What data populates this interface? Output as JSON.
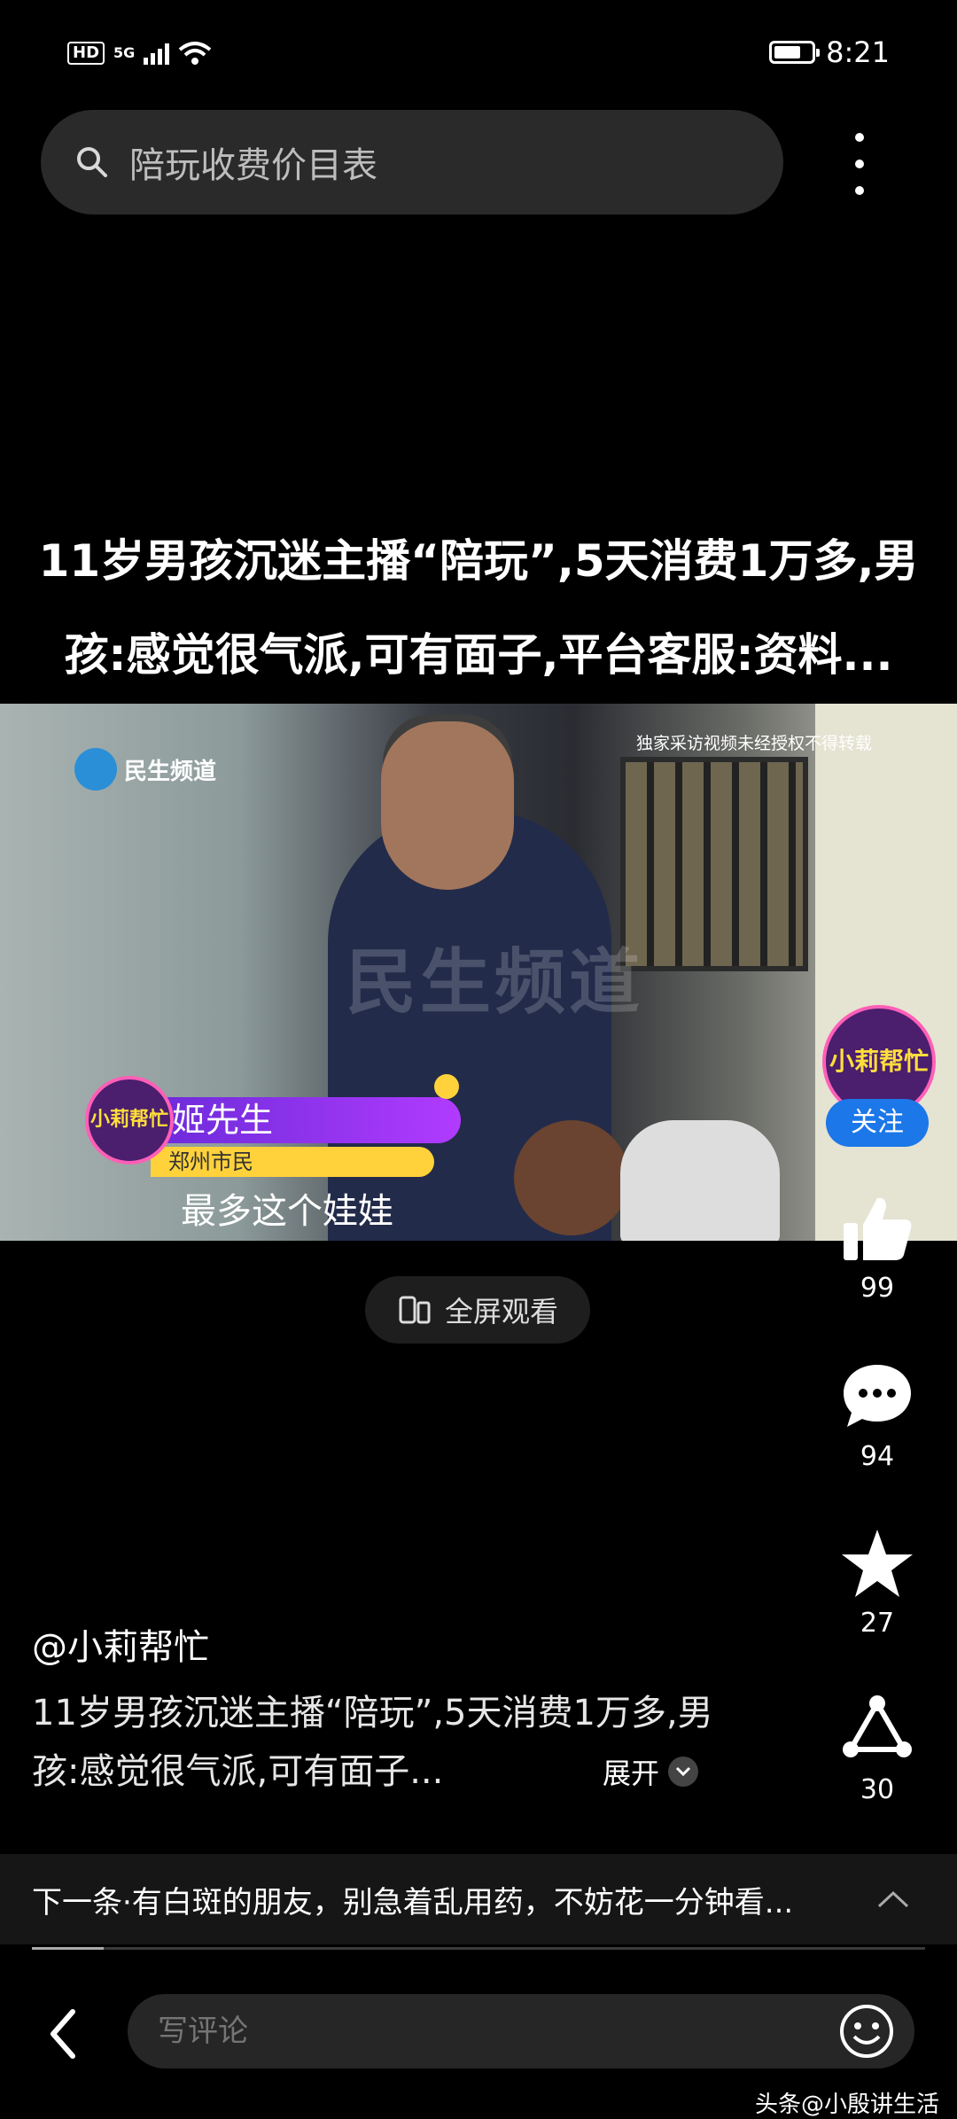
{
  "status_bar": {
    "hd": "HD",
    "network": "5G",
    "time": "8:21",
    "battery_level": 0.75
  },
  "search": {
    "placeholder": "陪玩收费价目表"
  },
  "video_title": "11岁男孩沉迷主播“陪玩”,5天消费1万多,男孩:感觉很气派,可有面子,平台客服:资料...",
  "video": {
    "channel_logo": "民生频道",
    "rights_notice": "独家采访视频未经授权不得转载",
    "watermark": "民生频道",
    "badge_text": "小莉帮忙",
    "speaker_name": "姬先生",
    "speaker_role": "郑州市民",
    "caption": "最多这个娃娃",
    "corner_logo": "小莉帮忙",
    "follow_label": "关注"
  },
  "fullscreen_label": "全屏观看",
  "actions": {
    "likes": "99",
    "comments": "94",
    "favorites": "27",
    "shares": "30"
  },
  "post": {
    "author": "@小莉帮忙",
    "description": "11岁男孩沉迷主播“陪玩”,5天消费1万多,男孩:感觉很气派,可有面子...",
    "expand_label": "展开"
  },
  "next_up": "下一条·有白斑的朋友，别急着乱用药，不妨花一分钟看...",
  "playback_progress": 0.08,
  "comment_placeholder": "写评论",
  "watermark_bottom": "头条@小殷讲生活",
  "icons": {
    "search": "search-icon",
    "more": "more-vertical-icon",
    "like": "thumbs-up-icon",
    "comment": "comment-bubble-icon",
    "favorite": "star-icon",
    "share": "share-icon",
    "back": "back-arrow-icon",
    "emoji": "emoji-icon"
  }
}
